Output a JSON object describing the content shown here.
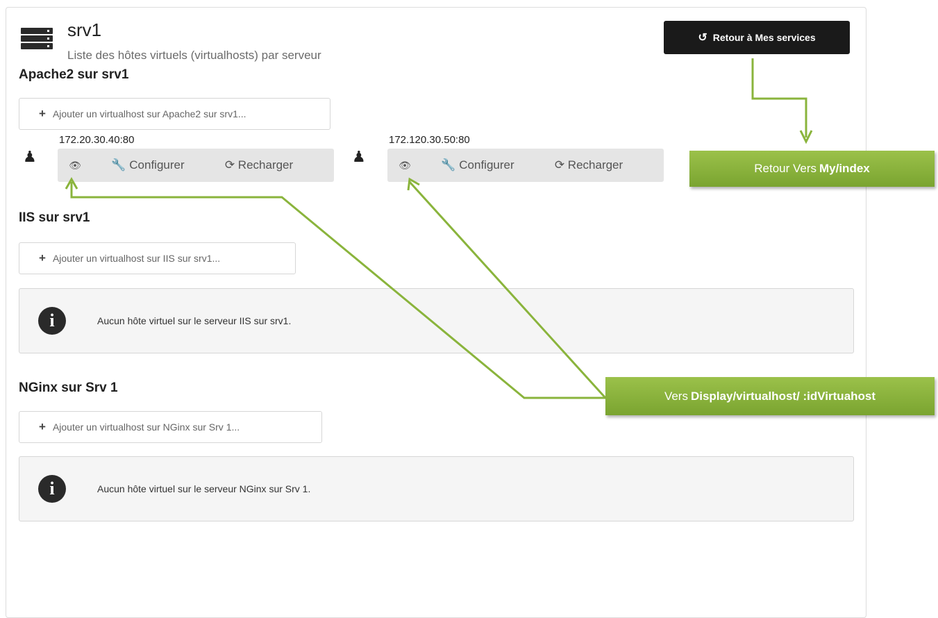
{
  "header": {
    "title": "srv1",
    "subtitle": "Liste des hôtes virtuels (virtualhosts) par serveur",
    "back_button": "Retour à Mes services",
    "back_icon": "undo-icon"
  },
  "sections": [
    {
      "title": "Apache2 sur srv1",
      "add_label": "Ajouter un virtualhost sur Apache2 sur srv1...",
      "vhosts": [
        {
          "address": "172.20.30.40:80",
          "configure": "Configurer",
          "reload": "Recharger"
        },
        {
          "address": "172.120.30.50:80",
          "configure": "Configurer",
          "reload": "Recharger"
        }
      ]
    },
    {
      "title": "IIS sur srv1",
      "add_label": "Ajouter un virtualhost sur IIS sur srv1...",
      "empty_message": "Aucun hôte virtuel sur le serveur IIS sur srv1."
    },
    {
      "title": "NGinx sur Srv 1",
      "add_label": "Ajouter un virtualhost sur NGinx sur Srv 1...",
      "empty_message": "Aucun hôte virtuel sur le serveur NGinx sur Srv 1."
    }
  ],
  "annotations": {
    "back_prefix": "Retour Vers",
    "back_target": "My/index",
    "display_prefix": "Vers",
    "display_target": "Display/virtualhost/ :idVirtuahost"
  },
  "colors": {
    "annotation_green": "#8ab43c",
    "button_dark": "#1a1a1a",
    "vhost_bar": "#e5e5e5"
  }
}
